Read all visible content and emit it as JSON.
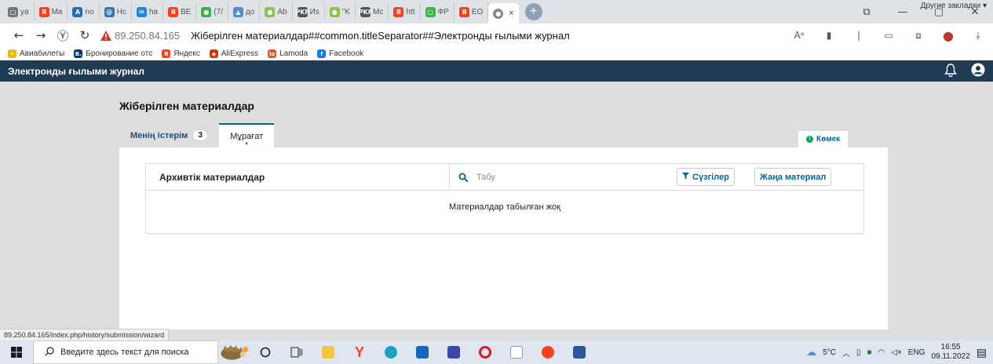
{
  "browser": {
    "tabs": [
      {
        "label": "ya",
        "icon": "page-icon",
        "color": "#777777",
        "glyph": "▢"
      },
      {
        "label": "Ma",
        "icon": "yandex-icon",
        "color": "#fc3f1d",
        "glyph": "Я"
      },
      {
        "label": "no",
        "icon": "app-icon",
        "color": "#2b6cb0",
        "glyph": "A"
      },
      {
        "label": "Hc",
        "icon": "mail-icon",
        "color": "#2b77c4",
        "glyph": "@"
      },
      {
        "label": "ha",
        "icon": "mail-icon",
        "color": "#1e88e5",
        "glyph": "✉"
      },
      {
        "label": "BE",
        "icon": "yandex-icon",
        "color": "#fc3f1d",
        "glyph": "Я"
      },
      {
        "label": "(7/",
        "icon": "app-icon",
        "color": "#3bb54a",
        "glyph": "●"
      },
      {
        "label": "до",
        "icon": "app-icon",
        "color": "#4a90d9",
        "glyph": "▲"
      },
      {
        "label": "Ab",
        "icon": "app-icon",
        "color": "#8bc34a",
        "glyph": "●"
      },
      {
        "label": "Иs",
        "icon": "app-icon",
        "color": "#555555",
        "glyph": "PKF"
      },
      {
        "label": "\"K",
        "icon": "app-icon",
        "color": "#8bc34a",
        "glyph": "●"
      },
      {
        "label": "Mc",
        "icon": "app-icon",
        "color": "#555555",
        "glyph": "PKF"
      },
      {
        "label": "htt",
        "icon": "yandex-icon",
        "color": "#fc3f1d",
        "glyph": "Я"
      },
      {
        "label": "ФР",
        "icon": "app-icon",
        "color": "#3bb54a",
        "glyph": "▢"
      },
      {
        "label": "EO",
        "icon": "yandex-icon",
        "color": "#fc3f1d",
        "glyph": "Я"
      }
    ],
    "active_tab_close": "×",
    "new_tab": "+",
    "address": {
      "host": "89.250.84.165",
      "title": "Жіберілген материалдар##common.titleSeparator##Электронды ғылыми журнал"
    },
    "bookmarks": [
      {
        "label": "Авиабилеты",
        "icon": "plane-icon",
        "color": "#f2b600",
        "glyph": "✈"
      },
      {
        "label": "Бронирование отс",
        "icon": "booking-icon",
        "color": "#003580",
        "glyph": "B."
      },
      {
        "label": "Яндекс",
        "icon": "yandex-icon",
        "color": "#fc3f1d",
        "glyph": "Я"
      },
      {
        "label": "AliExpress",
        "icon": "aliexpress-icon",
        "color": "#e62e04",
        "glyph": "◆"
      },
      {
        "label": "Lamoda",
        "icon": "lamoda-icon",
        "color": "#f04e23",
        "glyph": "lo"
      },
      {
        "label": "Facebook",
        "icon": "facebook-icon",
        "color": "#1877f2",
        "glyph": "f"
      }
    ],
    "other_bookmarks": "Другие закладки ▾",
    "status_url": "89.250.84.165/index.php/history/submission/wizard"
  },
  "app": {
    "title": "Электронды ғылыми журнал",
    "page_title": "Жіберілген материалдар",
    "tabs": {
      "my_queue": "Менің істерім",
      "my_queue_count": "3",
      "archive": "Мұрағат"
    },
    "help": "Көмек",
    "list": {
      "title": "Архивтік материалдар",
      "search_placeholder": "Табу",
      "filters": "Сүзгілер",
      "new_submission": "Жаңа материал",
      "empty": "Материалдар табылған жоқ"
    }
  },
  "taskbar": {
    "search_placeholder": "Введите здесь текст для поиска",
    "weather": "5°C",
    "lang": "ENG",
    "time": "16:55",
    "date": "09.11.2022"
  },
  "colors": {
    "header_bg": "#1f3c54",
    "accent": "#006798",
    "warning": "#d93025"
  }
}
